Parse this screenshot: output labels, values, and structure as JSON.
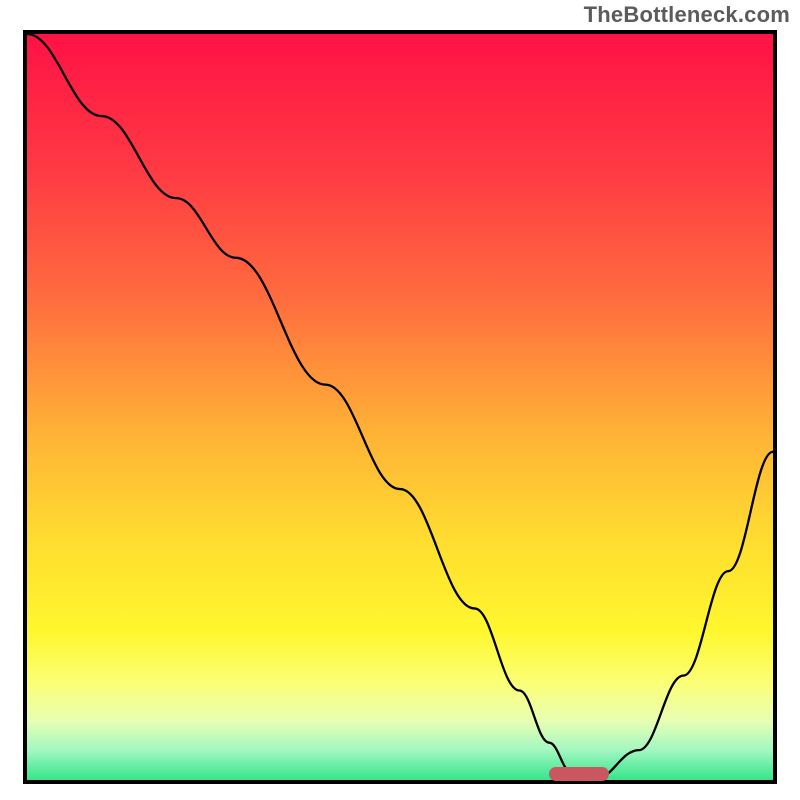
{
  "watermark": "TheBottleneck.com",
  "colors": {
    "border": "#000000",
    "curve": "#000000",
    "marker": "#ca5660",
    "gradient_stops": [
      {
        "offset": 0.0,
        "color": "#ff1246"
      },
      {
        "offset": 0.18,
        "color": "#ff3943"
      },
      {
        "offset": 0.36,
        "color": "#ff6e3e"
      },
      {
        "offset": 0.54,
        "color": "#ffb436"
      },
      {
        "offset": 0.68,
        "color": "#ffdd2f"
      },
      {
        "offset": 0.8,
        "color": "#fff72d"
      },
      {
        "offset": 0.87,
        "color": "#fbff76"
      },
      {
        "offset": 0.92,
        "color": "#e8ffb3"
      },
      {
        "offset": 0.96,
        "color": "#a2f7c1"
      },
      {
        "offset": 1.0,
        "color": "#34e58b"
      }
    ]
  },
  "chart_data": {
    "type": "line",
    "title": "",
    "xlabel": "",
    "ylabel": "",
    "xlim": [
      0,
      100
    ],
    "ylim": [
      0,
      100
    ],
    "grid": false,
    "annotations": [
      "TheBottleneck.com"
    ],
    "series": [
      {
        "name": "curve",
        "x": [
          0,
          10,
          20,
          28,
          40,
          50,
          60,
          66,
          70,
          73,
          76,
          82,
          88,
          94,
          100
        ],
        "y": [
          100,
          89,
          78,
          70,
          53,
          39,
          23,
          12,
          5,
          1,
          0,
          4,
          14,
          28,
          44
        ]
      }
    ],
    "marker": {
      "x_start": 70,
      "x_end": 78,
      "y": 0.8,
      "height": 2.0
    }
  }
}
